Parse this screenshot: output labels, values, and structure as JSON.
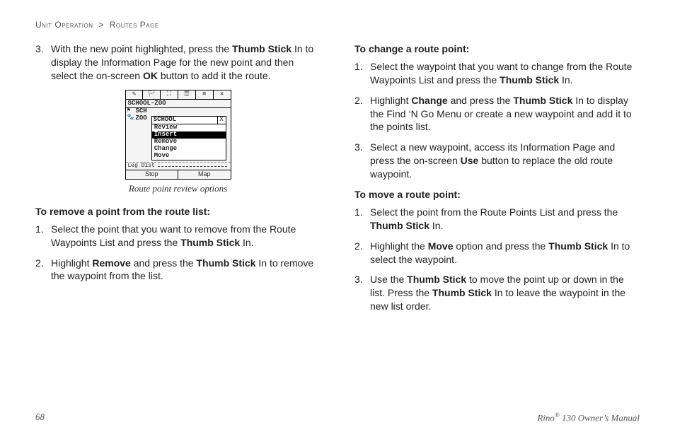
{
  "breadcrumb": {
    "a": "Unit Operation",
    "sep": ">",
    "b": "Routes Page"
  },
  "left": {
    "step3_num": "3.",
    "step3_a": "With the new point highlighted, press the ",
    "step3_b": "Thumb Stick",
    "step3_c": " In to display the Information Page for the new point and then select the on-screen ",
    "step3_d": "OK",
    "step3_e": " button to add it the route.",
    "fig_caption": "Route point review options",
    "device": {
      "tb1": "✎",
      "tb2": "🏳",
      "tb3": "⛶",
      "tb4": "☰",
      "tb5": "≡",
      "tb6": "✕",
      "title": "SCHOOL-ZOO",
      "r1_icon": "⚑",
      "r1_lab": "SCH",
      "r2_icon": "🐾",
      "r2_lab": "ZOO",
      "menu_title": "SCHOOL",
      "menu_x": "X",
      "m1": "Review",
      "m2": "Insert",
      "m3": "Remove",
      "m4": "Change",
      "m5": "Move",
      "leg": "Leg Dist",
      "f1": "Stop",
      "f2": "Map"
    },
    "remove_head": "To remove a point from the route list:",
    "r1_num": "1.",
    "r1_a": "Select the point that you want to remove from the Route Waypoints List and press the ",
    "r1_b": "Thumb Stick",
    "r1_c": " In.",
    "r2_num": "2.",
    "r2_a": "Highlight ",
    "r2_b": "Remove",
    "r2_c": " and press the ",
    "r2_d": "Thumb Stick",
    "r2_e": " In to remove the waypoint from the list."
  },
  "right": {
    "change_head": "To change a route point:",
    "c1_num": "1.",
    "c1_a": "Select the waypoint that you want to change from the Route Waypoints List and press the ",
    "c1_b": "Thumb Stick",
    "c1_c": " In.",
    "c2_num": "2.",
    "c2_a": "Highlight ",
    "c2_b": "Change",
    "c2_c": " and press the ",
    "c2_d": "Thumb Stick",
    "c2_e": " In to display the Find ‘N Go Menu or create a new waypoint and add it to the points list.",
    "c3_num": "3.",
    "c3_a": "Select a new waypoint, access its Information Page and press the on-screen ",
    "c3_b": "Use",
    "c3_c": " button to replace the old route waypoint.",
    "move_head": "To move a route point:",
    "m1_num": "1.",
    "m1_a": "Select the point from the Route Points List and press the ",
    "m1_b": "Thumb Stick",
    "m1_c": " In.",
    "m2_num": "2.",
    "m2_a": "Highlight the ",
    "m2_b": "Move",
    "m2_c": " option and press the ",
    "m2_d": "Thumb Stick",
    "m2_e": " In to select the waypoint.",
    "m3_num": "3.",
    "m3_a": "Use the ",
    "m3_b": "Thumb Stick",
    "m3_c": " to move the point up or down in the list. Press the ",
    "m3_d": "Thumb Stick",
    "m3_e": " In to leave the waypoint in the new list order."
  },
  "footer": {
    "page": "68",
    "prod_a": "Rino",
    "prod_sup": "®",
    "prod_b": " 130 Owner’s Manual"
  }
}
